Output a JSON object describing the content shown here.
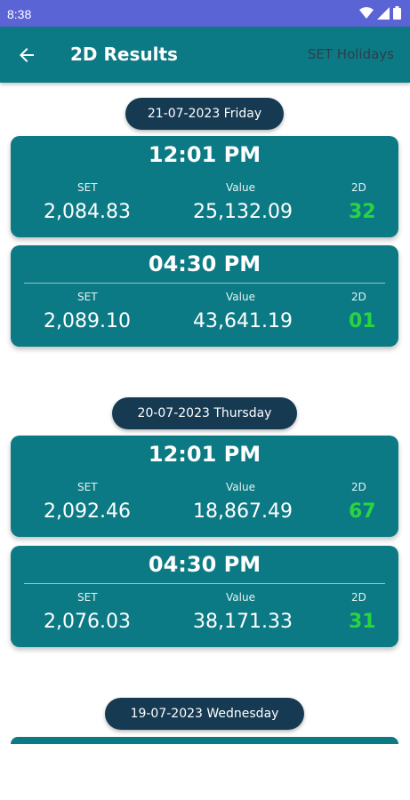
{
  "status_bar": {
    "time": "8:38"
  },
  "app_bar": {
    "title": "2D Results",
    "action": "SET Holidays"
  },
  "columns": {
    "set": "SET",
    "value": "Value",
    "two_d": "2D"
  },
  "days": [
    {
      "date": "21-07-2023 Friday",
      "results": [
        {
          "time": "12:01 PM",
          "set": "2,084.83",
          "value": "25,132.09",
          "two_d": "32"
        },
        {
          "time": "04:30 PM",
          "set": "2,089.10",
          "value": "43,641.19",
          "two_d": "01"
        }
      ]
    },
    {
      "date": "20-07-2023 Thursday",
      "results": [
        {
          "time": "12:01 PM",
          "set": "2,092.46",
          "value": "18,867.49",
          "two_d": "67"
        },
        {
          "time": "04:30 PM",
          "set": "2,076.03",
          "value": "38,171.33",
          "two_d": "31"
        }
      ]
    },
    {
      "date": "19-07-2023 Wednesday",
      "results": []
    }
  ],
  "colors": {
    "status_bar": "#5b64d4",
    "app_bar": "#0c7a84",
    "card": "#0c7a84",
    "date_pill": "#153a52",
    "two_d_text": "#2ad43f",
    "action_text": "#2f3e4a"
  }
}
